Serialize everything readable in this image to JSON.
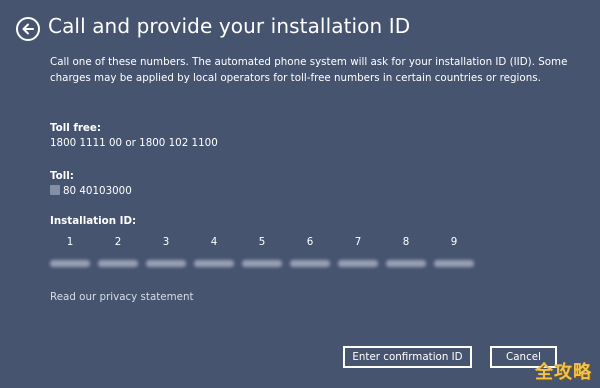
{
  "header": {
    "title": "Call and provide your installation ID"
  },
  "description": "Call one of these numbers. The automated phone system will ask for your installation ID (IID). Some charges may be applied by local operators for toll-free numbers in certain countries or regions.",
  "toll_free": {
    "label": "Toll free:",
    "value": "1800 1111 00 or 1800 102 1100"
  },
  "toll": {
    "label": "Toll:",
    "value": "80 40103000"
  },
  "installation_id": {
    "label": "Installation ID:",
    "groups": [
      "1",
      "2",
      "3",
      "4",
      "5",
      "6",
      "7",
      "8",
      "9"
    ]
  },
  "privacy_link": "Read our privacy statement",
  "buttons": {
    "confirm": "Enter confirmation ID",
    "cancel": "Cancel"
  },
  "watermark": "全攻略",
  "colors": {
    "background": "#475470",
    "text": "#ffffff",
    "watermark": "#f3c24a"
  }
}
